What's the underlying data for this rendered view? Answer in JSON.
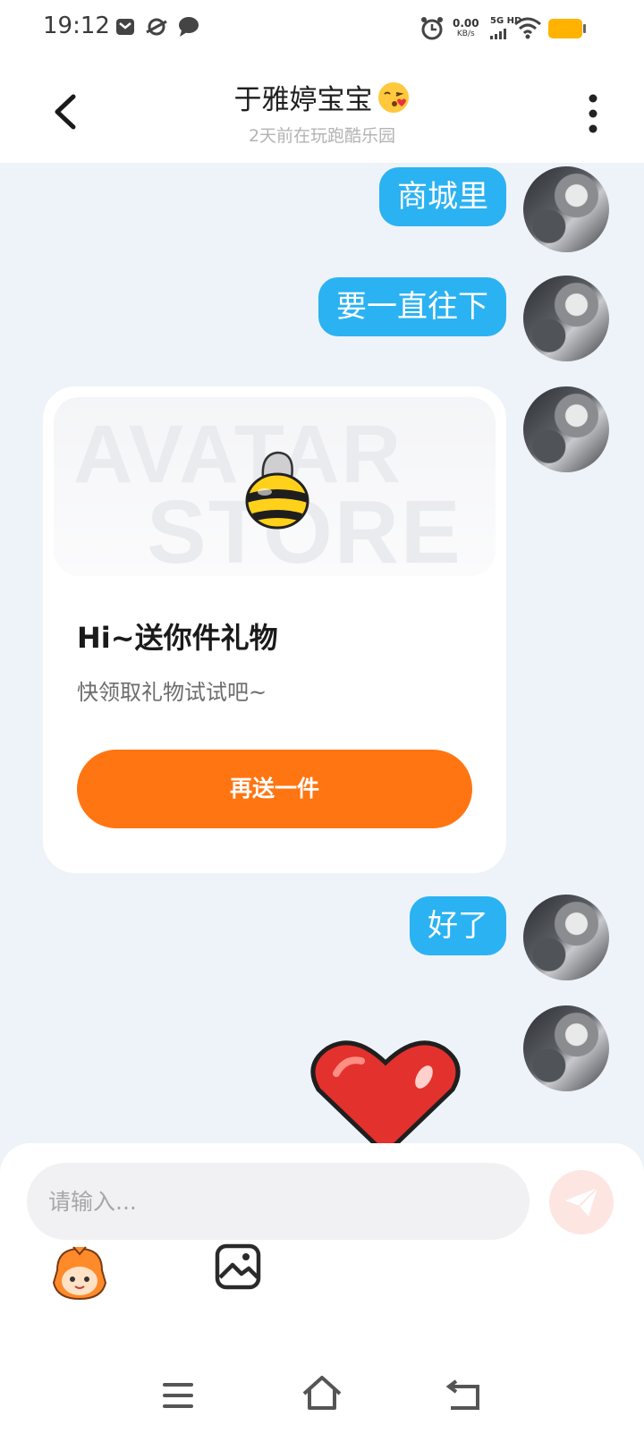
{
  "status_bar": {
    "time": "19:12",
    "net_speed_value": "0.00",
    "net_speed_unit": "KB/s",
    "net_type": "5G HD",
    "icons": [
      "mail-icon",
      "planet-icon",
      "chat-icon",
      "alarm-icon",
      "signal-icon",
      "wifi-icon",
      "battery-icon"
    ]
  },
  "header": {
    "contact_name": "于雅婷宝宝",
    "contact_emoji": "kiss-emoji-icon",
    "contact_status": "2天前在玩跑酷乐园"
  },
  "messages": [
    {
      "type": "text",
      "text": "商城里"
    },
    {
      "type": "text",
      "text": "要一直往下"
    },
    {
      "type": "gift",
      "banner_words": [
        "AVATAR",
        "STORE"
      ],
      "title": "Hi~送你件礼物",
      "subtitle": "快领取礼物试试吧~",
      "button_label": "再送一件"
    },
    {
      "type": "text",
      "text": "好了"
    },
    {
      "type": "sticker",
      "icon": "red-heart-sticker-icon"
    }
  ],
  "composer": {
    "placeholder": "请输入...",
    "tools": [
      "mascot-emoji-icon",
      "image-picker-icon"
    ]
  },
  "colors": {
    "bubble": "#2bb2f2",
    "accent_orange": "#ff7512",
    "background": "#eef3f9"
  }
}
